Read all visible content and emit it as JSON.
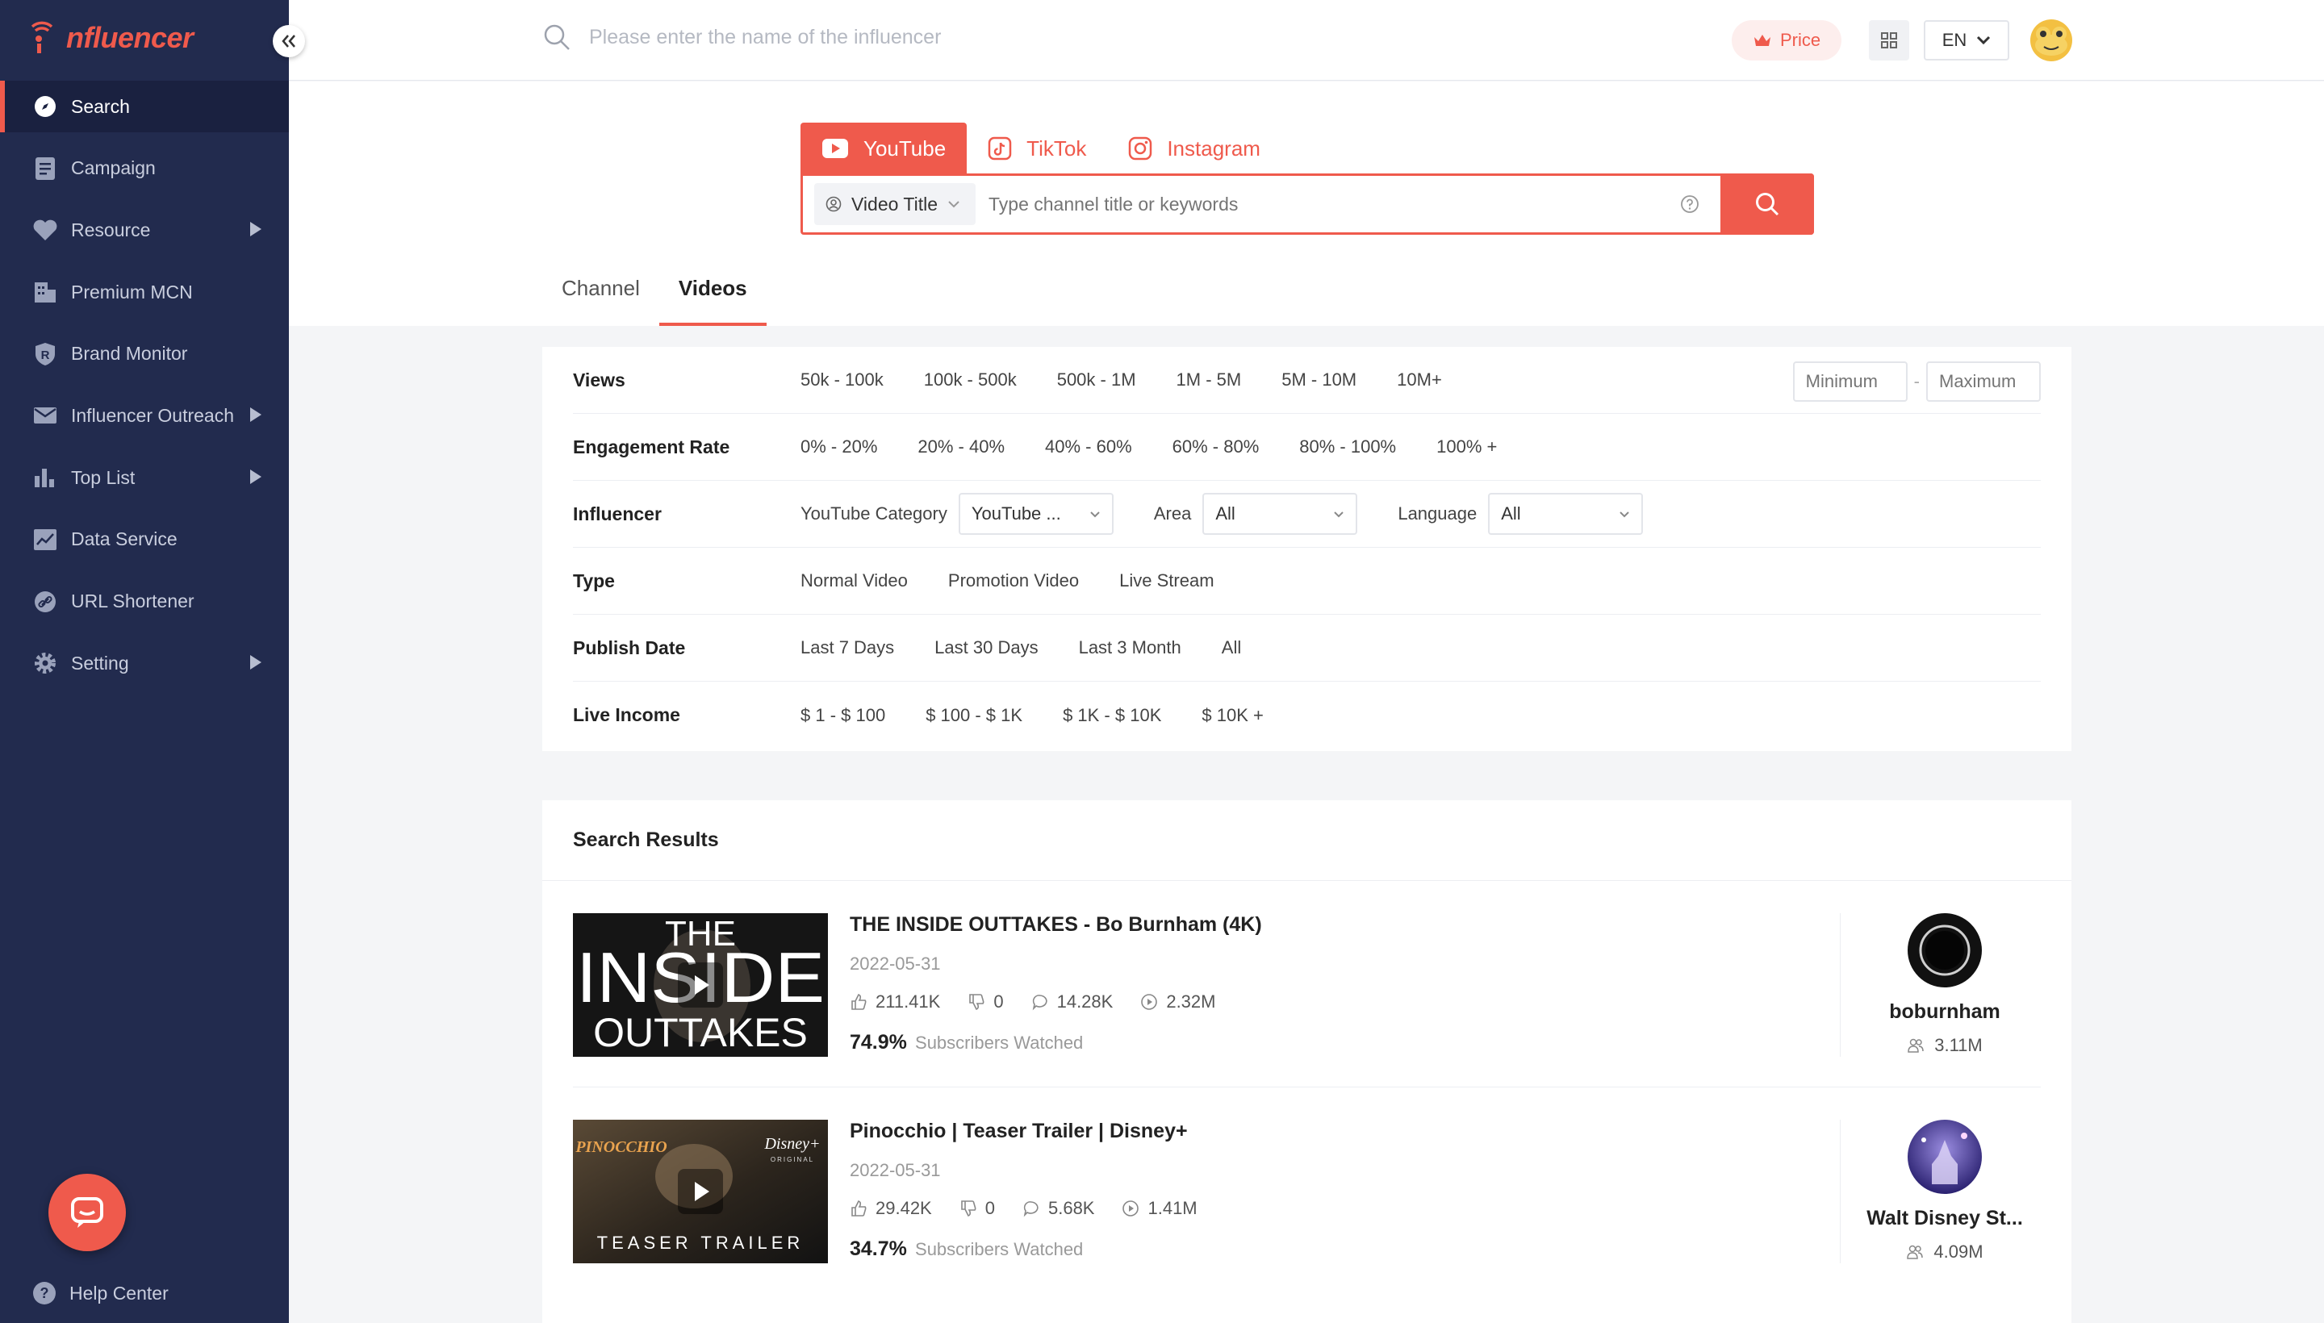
{
  "app": {
    "logo_text": "nfluencer",
    "brand_color": "#ef5a4c",
    "sidebar_color": "#222b4e"
  },
  "sidebar": {
    "items": [
      {
        "label": "Search",
        "icon": "compass-icon",
        "active": true
      },
      {
        "label": "Campaign",
        "icon": "document-icon"
      },
      {
        "label": "Resource",
        "icon": "heart-icon",
        "has_submenu": true
      },
      {
        "label": "Premium MCN",
        "icon": "building-icon"
      },
      {
        "label": "Brand Monitor",
        "icon": "shield-r-icon"
      },
      {
        "label": "Influencer Outreach",
        "icon": "mail-icon",
        "has_submenu": true
      },
      {
        "label": "Top List",
        "icon": "bar-chart-icon",
        "has_submenu": true
      },
      {
        "label": "Data Service",
        "icon": "line-chart-icon"
      },
      {
        "label": "URL Shortener",
        "icon": "link-icon"
      },
      {
        "label": "Setting",
        "icon": "gear-icon",
        "has_submenu": true
      }
    ],
    "help_label": "Help Center"
  },
  "topbar": {
    "search_placeholder": "Please enter the name of the influencer",
    "price_label": "Price",
    "language": "EN"
  },
  "platform_tabs": [
    {
      "label": "YouTube",
      "active": true
    },
    {
      "label": "TikTok"
    },
    {
      "label": "Instagram"
    }
  ],
  "search": {
    "type_selected": "Video Title",
    "keyword_placeholder": "Type channel title or keywords"
  },
  "content_tabs": [
    {
      "label": "Channel"
    },
    {
      "label": "Videos",
      "active": true
    }
  ],
  "filters": {
    "views": {
      "label": "Views",
      "options": [
        "50k - 100k",
        "100k - 500k",
        "500k - 1M",
        "1M - 5M",
        "5M - 10M",
        "10M+"
      ],
      "min_placeholder": "Minimum",
      "max_placeholder": "Maximum"
    },
    "engagement": {
      "label": "Engagement Rate",
      "options": [
        "0% - 20%",
        "20% - 40%",
        "40% - 60%",
        "60% - 80%",
        "80% - 100%",
        "100% +"
      ]
    },
    "influencer": {
      "label": "Influencer",
      "category_label": "YouTube Category",
      "category_value": "YouTube ...",
      "area_label": "Area",
      "area_value": "All",
      "language_label": "Language",
      "language_value": "All"
    },
    "type": {
      "label": "Type",
      "options": [
        "Normal Video",
        "Promotion Video",
        "Live Stream"
      ]
    },
    "publish": {
      "label": "Publish Date",
      "options": [
        "Last 7 Days",
        "Last 30 Days",
        "Last 3 Month",
        "All"
      ]
    },
    "income": {
      "label": "Live Income",
      "options": [
        "$ 1 - $ 100",
        "$ 100 - $ 1K",
        "$ 1K - $ 10K",
        "$ 10K +"
      ]
    }
  },
  "results": {
    "title": "Search Results",
    "items": [
      {
        "title": "THE INSIDE OUTTAKES - Bo Burnham (4K)",
        "date": "2022-05-31",
        "likes": "211.41K",
        "dislikes": "0",
        "comments": "14.28K",
        "views": "2.32M",
        "watched_pct": "74.9%",
        "watched_label": "Subscribers Watched",
        "thumb_line1": "THE",
        "thumb_line2": "INSIDE",
        "thumb_line3": "OUTTAKES",
        "channel": "boburnham",
        "subscribers": "3.11M"
      },
      {
        "title": "Pinocchio | Teaser Trailer | Disney+",
        "date": "2022-05-31",
        "likes": "29.42K",
        "dislikes": "0",
        "comments": "5.68K",
        "views": "1.41M",
        "watched_pct": "34.7%",
        "watched_label": "Subscribers Watched",
        "thumb_brand": "PINOCCHIO",
        "thumb_logo": "Disney+",
        "thumb_sub": "ORIGINAL",
        "thumb_caption": "TEASER TRAILER",
        "channel": "Walt Disney St...",
        "subscribers": "4.09M"
      }
    ]
  }
}
